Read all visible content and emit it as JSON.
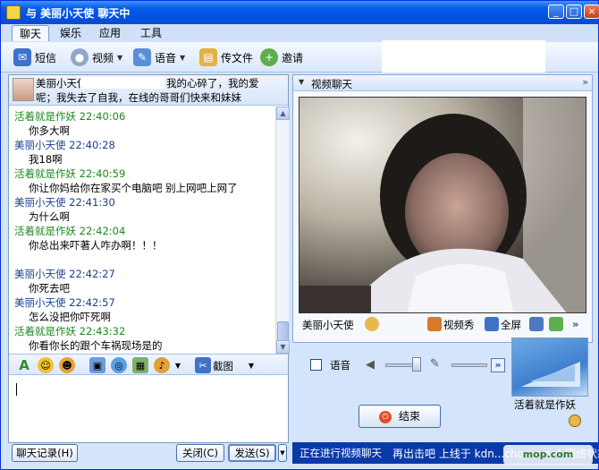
{
  "window": {
    "title": "与 美丽小天使 聊天中",
    "min_label": "_",
    "max_label": "□",
    "close_label": "×"
  },
  "menu": {
    "tabs": [
      {
        "label": "聊天"
      },
      {
        "label": "娱乐"
      },
      {
        "label": "应用"
      },
      {
        "label": "工具"
      }
    ]
  },
  "toolbar": {
    "sms": "短信",
    "video": "视频",
    "voice": "语音",
    "file": "传文件",
    "invite": "邀请"
  },
  "contact": {
    "name": "美丽小天使",
    "signature_line1": "我的心碎了，我的爱",
    "signature_line2": "呢；我失去了自我，在线的哥哥们快来和妹妹"
  },
  "messages": [
    {
      "sender": "活着就是作妖",
      "time": "22:40:06",
      "text": "你多大啊",
      "color": "green"
    },
    {
      "sender": "美丽小天使",
      "time": "22:40:28",
      "text": "我18啊",
      "color": "blue"
    },
    {
      "sender": "活着就是作妖",
      "time": "22:40:59",
      "text": "你让你妈给你在家买个电脑吧 别上网吧上网了",
      "color": "green"
    },
    {
      "sender": "美丽小天使",
      "time": "22:41:30",
      "text": "为什么啊",
      "color": "blue"
    },
    {
      "sender": "活着就是作妖",
      "time": "22:42:04",
      "text": "你总出来吓著人咋办啊！！！",
      "color": "green"
    },
    {
      "sender": "美丽小天使",
      "time": "22:42:27",
      "text": "你死去吧",
      "color": "blue"
    },
    {
      "sender": "美丽小天使",
      "time": "22:42:57",
      "text": "怎么没把你吓死啊",
      "color": "blue"
    },
    {
      "sender": "活着就是作妖",
      "time": "22:43:32",
      "text": "你看你长的跟个车祸现场是的",
      "color": "green"
    }
  ],
  "edit_toolbar": {
    "screenshot": "截图"
  },
  "bottom": {
    "history": "聊天记录(H)",
    "close": "关闭(C)",
    "send": "发送(S)"
  },
  "video_panel": {
    "title": "视频聊天",
    "more": "»",
    "remote_name": "美丽小天使",
    "video_show": "视频秀",
    "fullscreen": "全屏"
  },
  "audio": {
    "label": "语音"
  },
  "end_button": "结束",
  "self_name": "活着就是作妖",
  "status": {
    "text": "正在进行视频聊天",
    "tail": "再出击吧  上线于 kdn...chome.net  网络状态"
  },
  "watermark": "mop.com"
}
